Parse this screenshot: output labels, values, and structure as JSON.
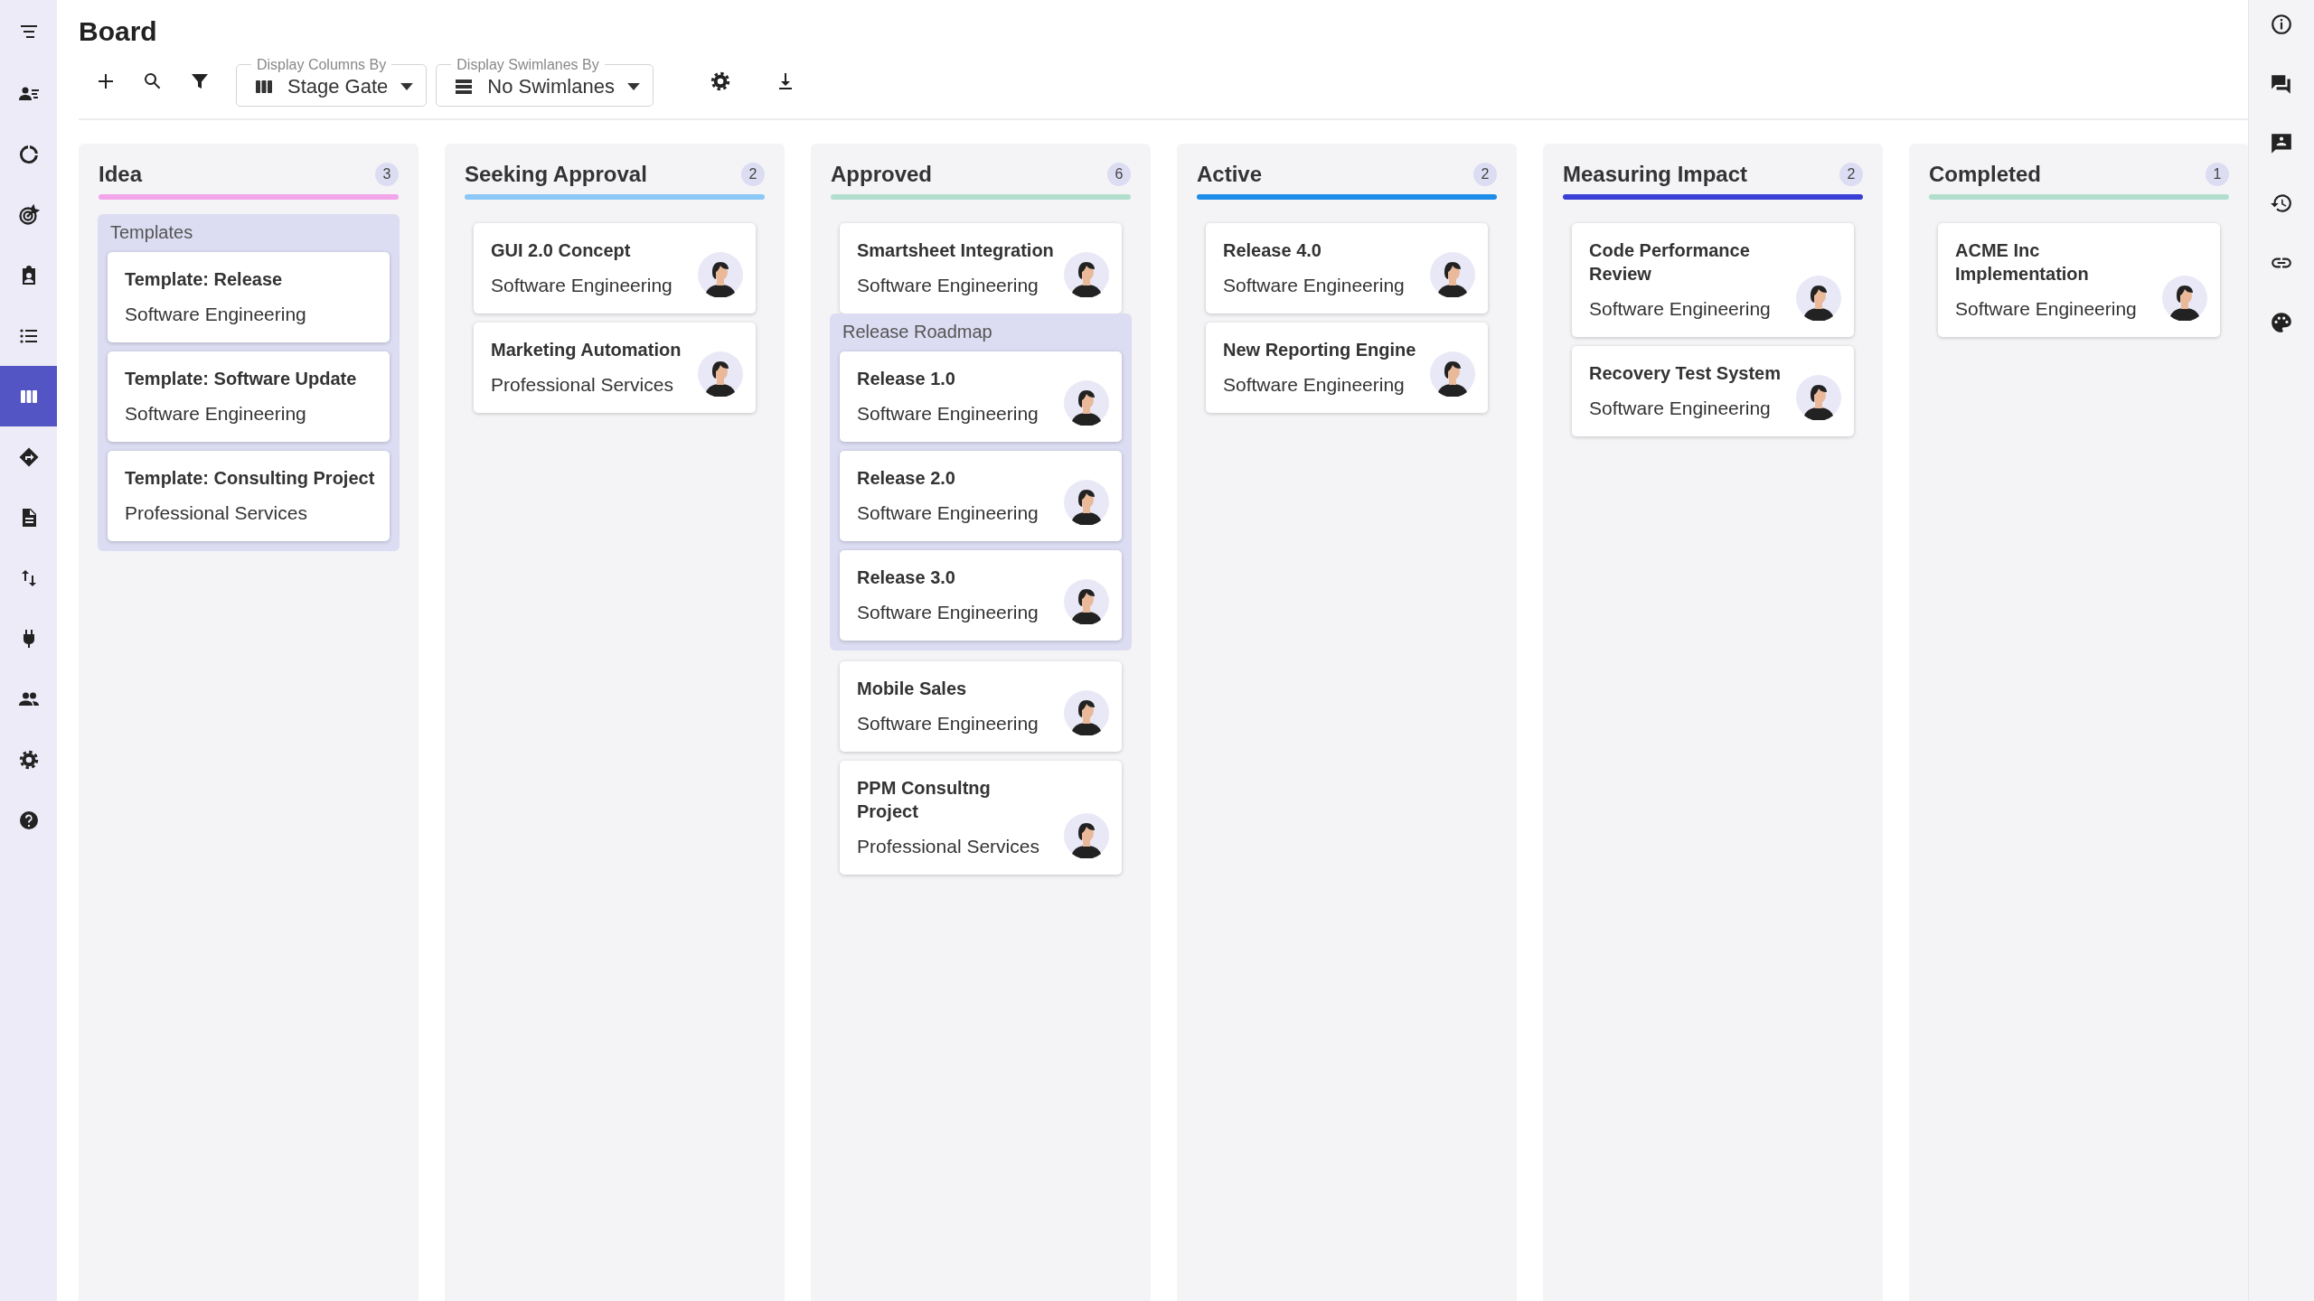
{
  "page": {
    "title": "Board"
  },
  "nav_items": [
    {
      "selected": false
    },
    {
      "selected": false
    },
    {
      "selected": false
    },
    {
      "selected": false
    },
    {
      "selected": false
    },
    {
      "selected": true
    },
    {
      "selected": false
    },
    {
      "selected": false
    },
    {
      "selected": false
    },
    {
      "selected": false
    },
    {
      "selected": false
    },
    {
      "selected": false
    },
    {
      "selected": false
    }
  ],
  "toolbar": {
    "column_select": {
      "label": "Display Columns By",
      "value": "Stage Gate"
    },
    "swimlane_select": {
      "label": "Display Swimlanes By",
      "value": "No Swimlanes"
    }
  },
  "columns": [
    {
      "title": "Idea",
      "count": "3",
      "color": "#f3a5ea",
      "items": [
        {
          "kind": "group",
          "title": "Templates",
          "cards": [
            {
              "title": "Template: Release",
              "team": "Software Engineering",
              "avatar": false
            },
            {
              "title": "Template: Software Update",
              "team": "Software Engineering",
              "avatar": false
            },
            {
              "title": "Template: Consulting Project",
              "team": "Professional Services",
              "avatar": false
            }
          ]
        }
      ]
    },
    {
      "title": "Seeking Approval",
      "count": "2",
      "color": "#8cc8f5",
      "items": [
        {
          "kind": "card",
          "title": "GUI 2.0 Concept",
          "team": "Software Engineering",
          "avatar": true
        },
        {
          "kind": "card",
          "title": "Marketing Automation",
          "team": "Professional Services",
          "avatar": true
        }
      ]
    },
    {
      "title": "Approved",
      "count": "6",
      "color": "#b2dfcd",
      "items": [
        {
          "kind": "card",
          "title": "Smartsheet Integration",
          "team": "Software Engineering",
          "avatar": true
        },
        {
          "kind": "group",
          "title": "Release Roadmap",
          "cards": [
            {
              "title": "Release 1.0",
              "team": "Software Engineering",
              "avatar": true
            },
            {
              "title": "Release 2.0",
              "team": "Software Engineering",
              "avatar": true
            },
            {
              "title": "Release 3.0",
              "team": "Software Engineering",
              "avatar": true
            }
          ]
        },
        {
          "kind": "card",
          "title": "Mobile Sales",
          "team": "Software Engineering",
          "avatar": true
        },
        {
          "kind": "card",
          "title": "PPM Consultng Project",
          "team": "Professional Services",
          "avatar": true
        }
      ]
    },
    {
      "title": "Active",
      "count": "2",
      "color": "#1e8de8",
      "items": [
        {
          "kind": "card",
          "title": "Release 4.0",
          "team": "Software Engineering",
          "avatar": true
        },
        {
          "kind": "card",
          "title": "New Reporting Engine",
          "team": "Software Engineering",
          "avatar": true
        }
      ]
    },
    {
      "title": "Measuring Impact",
      "count": "2",
      "color": "#3a3fd6",
      "items": [
        {
          "kind": "card",
          "title": "Code Performance Review",
          "team": "Software Engineering",
          "avatar": true
        },
        {
          "kind": "card",
          "title": "Recovery Test System",
          "team": "Software Engineering",
          "avatar": true
        }
      ]
    },
    {
      "title": "Completed",
      "count": "1",
      "color": "#b2dfcd",
      "items": [
        {
          "kind": "card",
          "title": "ACME Inc Implementation",
          "team": "Software Engineering",
          "avatar": true
        }
      ]
    }
  ]
}
